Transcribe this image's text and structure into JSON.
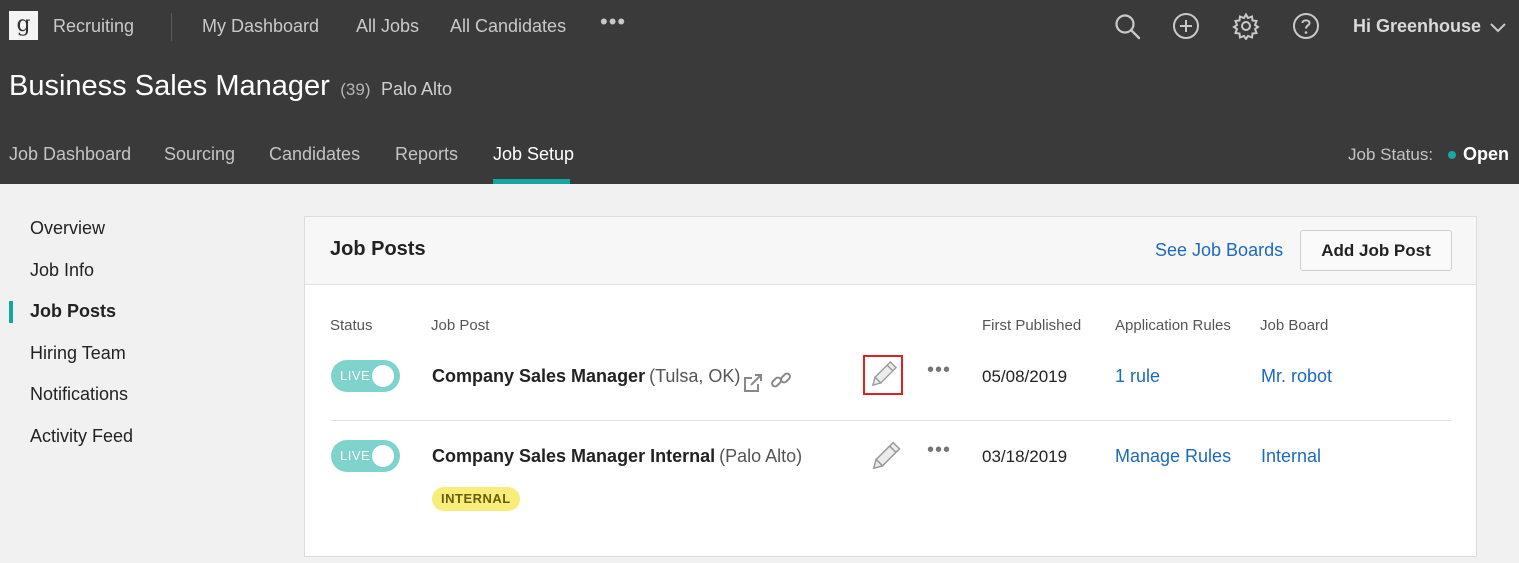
{
  "topbar": {
    "logo_letter": "g",
    "app_name": "Recruiting",
    "nav": [
      "My Dashboard",
      "All Jobs",
      "All Candidates"
    ],
    "more": "•••",
    "greeting": "Hi Greenhouse",
    "icons": [
      "search-icon",
      "add-circle-icon",
      "gear-icon",
      "help-icon",
      "chevron-down-icon"
    ]
  },
  "job": {
    "title": "Business Sales Manager",
    "count": "(39)",
    "location": "Palo Alto"
  },
  "subnav": {
    "tabs": [
      "Job Dashboard",
      "Sourcing",
      "Candidates",
      "Reports",
      "Job Setup"
    ],
    "active": "Job Setup",
    "status_label": "Job Status:",
    "status_value": "Open"
  },
  "sidebar": {
    "items": [
      "Overview",
      "Job Info",
      "Job Posts",
      "Hiring Team",
      "Notifications",
      "Activity Feed"
    ],
    "active": "Job Posts"
  },
  "card": {
    "title": "Job Posts",
    "see_boards": "See Job Boards",
    "add_button": "Add Job Post",
    "columns": [
      "Status",
      "Job Post",
      "First Published",
      "Application Rules",
      "Job Board"
    ],
    "rows": [
      {
        "status": "LIVE",
        "name": "Company Sales Manager",
        "location": "(Tulsa, OK)",
        "published": "05/08/2019",
        "rules": "1 rule",
        "board": "Mr. robot"
      },
      {
        "status": "LIVE",
        "name": "Company Sales Manager Internal",
        "location": "(Palo Alto)",
        "published": "03/18/2019",
        "rules": "Manage Rules",
        "board": "Internal",
        "badge": "INTERNAL"
      }
    ],
    "row_more": "•••"
  },
  "colors": {
    "header_bg": "#3a3a3a",
    "accent": "#16a6a0",
    "link": "#1a6ac0",
    "toggle": "#7fd3cd",
    "highlight": "#e02020"
  }
}
